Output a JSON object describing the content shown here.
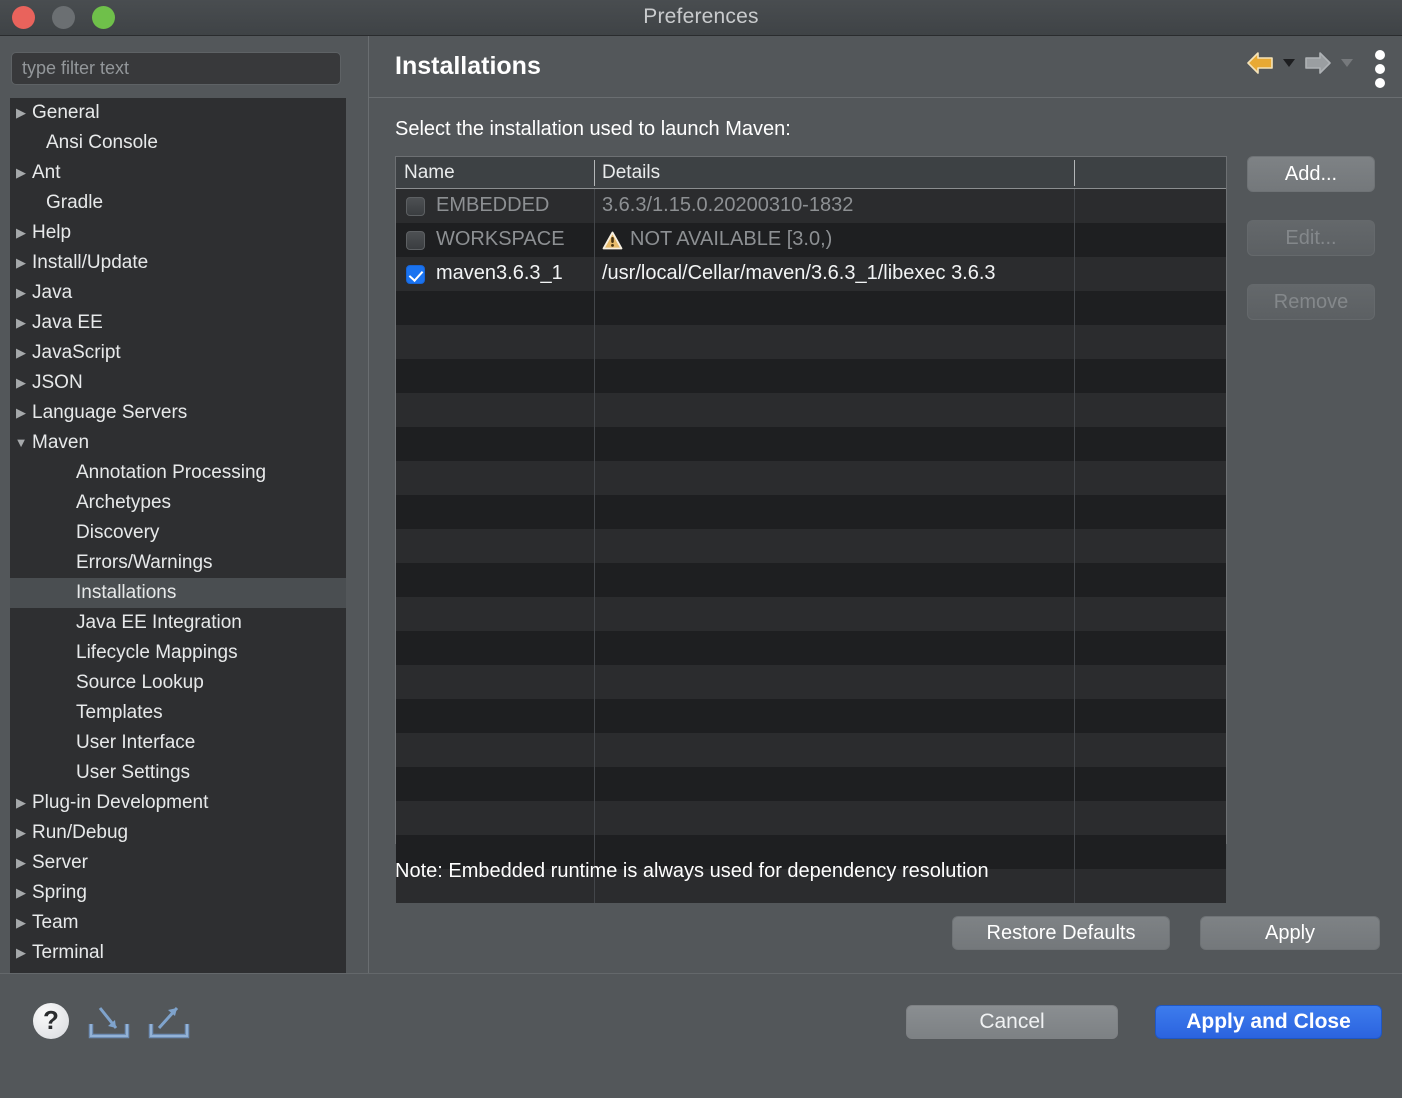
{
  "window": {
    "title": "Preferences",
    "controls": {
      "close": "close-button",
      "minimize": "minimize-button",
      "zoom": "zoom-button"
    }
  },
  "sidebar": {
    "filter_placeholder": "type filter text",
    "filter_value": "",
    "items": [
      {
        "label": "General",
        "level": 0,
        "arrow": "collapsed",
        "selected": false
      },
      {
        "label": "Ansi Console",
        "level": 0,
        "arrow": "none",
        "selected": false
      },
      {
        "label": "Ant",
        "level": 0,
        "arrow": "collapsed",
        "selected": false
      },
      {
        "label": "Gradle",
        "level": 0,
        "arrow": "none",
        "selected": false
      },
      {
        "label": "Help",
        "level": 0,
        "arrow": "collapsed",
        "selected": false
      },
      {
        "label": "Install/Update",
        "level": 0,
        "arrow": "collapsed",
        "selected": false
      },
      {
        "label": "Java",
        "level": 0,
        "arrow": "collapsed",
        "selected": false
      },
      {
        "label": "Java EE",
        "level": 0,
        "arrow": "collapsed",
        "selected": false
      },
      {
        "label": "JavaScript",
        "level": 0,
        "arrow": "collapsed",
        "selected": false
      },
      {
        "label": "JSON",
        "level": 0,
        "arrow": "collapsed",
        "selected": false
      },
      {
        "label": "Language Servers",
        "level": 0,
        "arrow": "collapsed",
        "selected": false
      },
      {
        "label": "Maven",
        "level": 0,
        "arrow": "expanded",
        "selected": false
      },
      {
        "label": "Annotation Processing",
        "level": 1,
        "arrow": "none",
        "selected": false
      },
      {
        "label": "Archetypes",
        "level": 1,
        "arrow": "none",
        "selected": false
      },
      {
        "label": "Discovery",
        "level": 1,
        "arrow": "none",
        "selected": false
      },
      {
        "label": "Errors/Warnings",
        "level": 1,
        "arrow": "none",
        "selected": false
      },
      {
        "label": "Installations",
        "level": 1,
        "arrow": "none",
        "selected": true
      },
      {
        "label": "Java EE Integration",
        "level": 1,
        "arrow": "none",
        "selected": false
      },
      {
        "label": "Lifecycle Mappings",
        "level": 1,
        "arrow": "none",
        "selected": false
      },
      {
        "label": "Source Lookup",
        "level": 1,
        "arrow": "none",
        "selected": false
      },
      {
        "label": "Templates",
        "level": 1,
        "arrow": "none",
        "selected": false
      },
      {
        "label": "User Interface",
        "level": 1,
        "arrow": "none",
        "selected": false
      },
      {
        "label": "User Settings",
        "level": 1,
        "arrow": "none",
        "selected": false
      },
      {
        "label": "Plug-in Development",
        "level": 0,
        "arrow": "collapsed",
        "selected": false
      },
      {
        "label": "Run/Debug",
        "level": 0,
        "arrow": "collapsed",
        "selected": false
      },
      {
        "label": "Server",
        "level": 0,
        "arrow": "collapsed",
        "selected": false
      },
      {
        "label": "Spring",
        "level": 0,
        "arrow": "collapsed",
        "selected": false
      },
      {
        "label": "Team",
        "level": 0,
        "arrow": "collapsed",
        "selected": false
      },
      {
        "label": "Terminal",
        "level": 0,
        "arrow": "collapsed",
        "selected": false
      }
    ]
  },
  "panel": {
    "title": "Installations",
    "nav": {
      "back_icon": "back-arrow-icon",
      "back_caret": "chevron-down-icon",
      "forward_icon": "forward-arrow-icon",
      "forward_caret": "chevron-down-icon",
      "menu_icon": "kebab-menu-icon",
      "back_color": "#e8a933",
      "forward_color": "#9a9ea1"
    },
    "select_label": "Select the installation used to launch Maven:",
    "table": {
      "columns": [
        "Name",
        "Details",
        ""
      ],
      "rows": [
        {
          "checked": false,
          "name": "EMBEDDED",
          "details": "3.6.3/1.15.0.20200310-1832",
          "warning": false,
          "dim": true
        },
        {
          "checked": false,
          "name": "WORKSPACE",
          "details": "NOT AVAILABLE [3.0,)",
          "warning": true,
          "dim": true
        },
        {
          "checked": true,
          "name": "maven3.6.3_1",
          "details": "/usr/local/Cellar/maven/3.6.3_1/libexec 3.6.3",
          "warning": false,
          "dim": false
        }
      ],
      "empty_row_count": 18
    },
    "buttons": {
      "add": "Add...",
      "edit": "Edit...",
      "remove": "Remove",
      "add_enabled": true,
      "edit_enabled": false,
      "remove_enabled": false
    },
    "note": "Note: Embedded runtime is always used for dependency resolution",
    "restore_defaults": "Restore Defaults",
    "apply": "Apply"
  },
  "footer": {
    "help_icon": "help-icon",
    "help_glyph": "?",
    "import_icon": "import-icon",
    "export_icon": "export-icon",
    "cancel": "Cancel",
    "apply_and_close": "Apply and Close",
    "primary_color": "#2b63df"
  }
}
